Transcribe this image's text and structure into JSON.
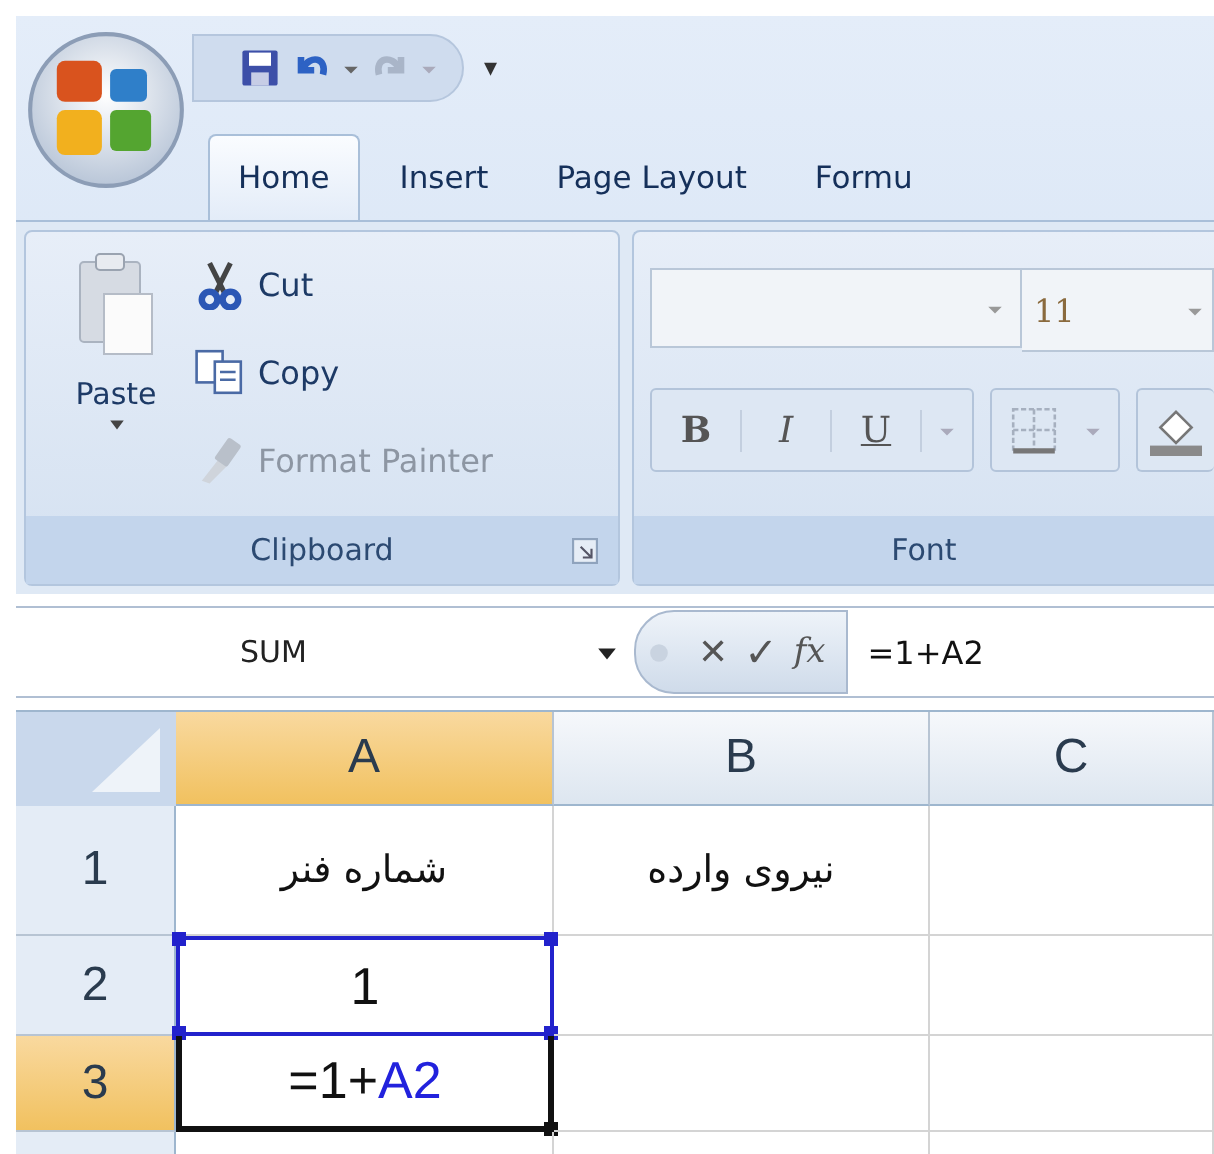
{
  "quick_access": {
    "customize": "▾"
  },
  "tabs": [
    {
      "label": "Home",
      "selected": true
    },
    {
      "label": "Insert",
      "selected": false
    },
    {
      "label": "Page Layout",
      "selected": false
    },
    {
      "label": "Formu",
      "selected": false
    }
  ],
  "clipboard": {
    "label": "Clipboard",
    "paste": "Paste",
    "items": [
      {
        "kind": "cut",
        "label": "Cut",
        "disabled": false
      },
      {
        "kind": "copy",
        "label": "Copy",
        "disabled": false
      },
      {
        "kind": "painter",
        "label": "Format Painter",
        "disabled": true
      }
    ]
  },
  "font": {
    "label": "Font",
    "font_size": "11",
    "bold": "B",
    "italic": "I",
    "underline": "U"
  },
  "formula_bar": {
    "name_box": "SUM",
    "cancel": "✕",
    "enter": "✓",
    "function": "fx",
    "formula": "=1+A2"
  },
  "columns": [
    {
      "label": "A",
      "selected": true
    },
    {
      "label": "B",
      "selected": false
    },
    {
      "label": "C",
      "selected": false
    }
  ],
  "rows": [
    {
      "label": "1",
      "selected": false,
      "cells": {
        "column_a": {
          "parts": [
            {
              "text": "شماره فنر",
              "reference": false
            }
          ],
          "active": false,
          "referenced": false
        },
        "column_b": {
          "parts": [
            {
              "text": "نیروی وارده",
              "reference": false
            }
          ],
          "active": false,
          "referenced": false
        },
        "column_c": {
          "active": false,
          "referenced": false
        }
      }
    },
    {
      "label": "2",
      "selected": false,
      "cells": {
        "column_a": {
          "parts": [
            {
              "text": "1",
              "reference": false
            }
          ],
          "active": false,
          "referenced": true
        },
        "column_b": {
          "active": false,
          "referenced": false
        },
        "column_c": {
          "active": false,
          "referenced": false
        }
      }
    },
    {
      "label": "3",
      "selected": true,
      "cells": {
        "column_a": {
          "parts": [
            {
              "text": "=1+",
              "reference": false
            },
            {
              "text": "A2",
              "reference": true
            }
          ],
          "active": true,
          "referenced": false
        },
        "column_b": {
          "active": false,
          "referenced": false
        },
        "column_c": {
          "active": false,
          "referenced": false
        }
      }
    }
  ]
}
